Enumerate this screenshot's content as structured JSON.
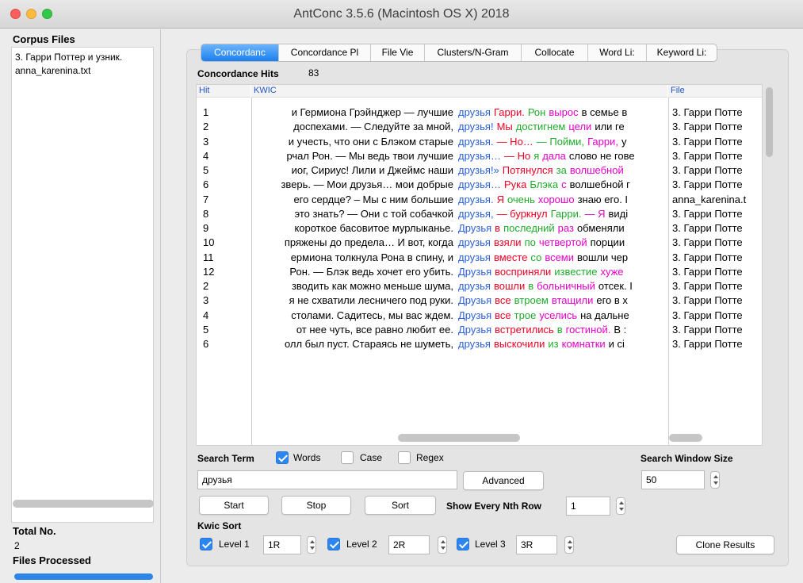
{
  "window": {
    "title": "AntConc 3.5.6 (Macintosh OS X) 2018"
  },
  "left_pane": {
    "corpus_heading": "Corpus Files",
    "files": [
      "3. Гарри Поттер и узник.",
      "anna_karenina.txt"
    ],
    "total_label": "Total No.",
    "total_value": "2",
    "files_processed_label": "Files Processed",
    "progress_fraction": 1.0
  },
  "tabs": [
    "Concordanc",
    "Concordance Pl",
    "File Vie",
    "Clusters/N-Gram",
    "Collocate",
    "Word Li:",
    "Keyword Li:"
  ],
  "active_tab": 0,
  "hits": {
    "label": "Concordance Hits",
    "count": "83"
  },
  "columns": {
    "hit": "Hit",
    "kwic": "KWIC",
    "file": "File"
  },
  "rows": [
    {
      "hit": "1",
      "left": "и Гермиона Грэйнджер — лучшие",
      "right": [
        [
          "друзья",
          "blue"
        ],
        [
          "Гарри.",
          "red"
        ],
        [
          "Рон",
          "green"
        ],
        [
          "вырос",
          "mag"
        ],
        [
          "в семье в",
          "black"
        ]
      ],
      "file": "3. Гарри Потте"
    },
    {
      "hit": "2",
      "left": "доспехами. — Следуйте за мной,",
      "right": [
        [
          "друзья!",
          "blue"
        ],
        [
          "Мы",
          "red"
        ],
        [
          "достигнем",
          "green"
        ],
        [
          "цели",
          "mag"
        ],
        [
          "или ге",
          "black"
        ]
      ],
      "file": "3. Гарри Потте"
    },
    {
      "hit": "3",
      "left": "и учесть, что они с Блэком старые",
      "right": [
        [
          "друзья.",
          "blue"
        ],
        [
          "— Но…",
          "red"
        ],
        [
          "— Пойми,",
          "green"
        ],
        [
          "Гарри,",
          "mag"
        ],
        [
          "у",
          "black"
        ]
      ],
      "file": "3. Гарри Потте"
    },
    {
      "hit": "4",
      "left": "рчал Рон. — Мы ведь твои лучшие",
      "right": [
        [
          "друзья…",
          "blue"
        ],
        [
          "— Но",
          "red"
        ],
        [
          "я",
          "green"
        ],
        [
          "дала",
          "mag"
        ],
        [
          "слово не гове",
          "black"
        ]
      ],
      "file": "3. Гарри Потте"
    },
    {
      "hit": "5",
      "left": "иог, Сириус! Лили и Джеймс наши",
      "right": [
        [
          "друзья!»",
          "blue"
        ],
        [
          "Потянулся",
          "red"
        ],
        [
          "за",
          "green"
        ],
        [
          "волшебной",
          "mag"
        ]
      ],
      "file": "3. Гарри Потте"
    },
    {
      "hit": "6",
      "left": "зверь. — Мои друзья… мои добрые",
      "right": [
        [
          "друзья…",
          "blue"
        ],
        [
          "Рука",
          "red"
        ],
        [
          "Блэка",
          "green"
        ],
        [
          "с",
          "mag"
        ],
        [
          "волшебной г",
          "black"
        ]
      ],
      "file": "3. Гарри Потте"
    },
    {
      "hit": "7",
      "left": "его сердце? – Мы с ним большие",
      "right": [
        [
          "друзья.",
          "blue"
        ],
        [
          "Я",
          "red"
        ],
        [
          "очень",
          "green"
        ],
        [
          "хорошо",
          "mag"
        ],
        [
          "знаю его. І",
          "black"
        ]
      ],
      "file": "anna_karenina.t"
    },
    {
      "hit": "8",
      "left": "это знать? — Они с той собачкой",
      "right": [
        [
          "друзья,",
          "blue"
        ],
        [
          "— буркнул",
          "red"
        ],
        [
          "Гарри.",
          "green"
        ],
        [
          "— Я",
          "mag"
        ],
        [
          "виді",
          "black"
        ]
      ],
      "file": "3. Гарри Потте"
    },
    {
      "hit": "9",
      "left": "короткое басовитое мурлыканье.",
      "right": [
        [
          "Друзья",
          "blue"
        ],
        [
          "в",
          "red"
        ],
        [
          "последний",
          "green"
        ],
        [
          "раз",
          "mag"
        ],
        [
          "обменяли",
          "black"
        ]
      ],
      "file": "3. Гарри Потте"
    },
    {
      "hit": "10",
      "left": "пряжены до предела… И вот, когда",
      "right": [
        [
          "друзья",
          "blue"
        ],
        [
          "взяли",
          "red"
        ],
        [
          "по",
          "green"
        ],
        [
          "четвертой",
          "mag"
        ],
        [
          "порции",
          "black"
        ]
      ],
      "file": "3. Гарри Потте"
    },
    {
      "hit": "11",
      "left": "ермиона толкнула Рона в спину, и",
      "right": [
        [
          "друзья",
          "blue"
        ],
        [
          "вместе",
          "red"
        ],
        [
          "со",
          "green"
        ],
        [
          "всеми",
          "mag"
        ],
        [
          "вошли чер",
          "black"
        ]
      ],
      "file": "3. Гарри Потте"
    },
    {
      "hit": "12",
      "left": "Рон. — Блэк ведь хочет его убить.",
      "right": [
        [
          "Друзья",
          "blue"
        ],
        [
          "восприняли",
          "red"
        ],
        [
          "известие",
          "green"
        ],
        [
          "хуже",
          "mag"
        ]
      ],
      "file": "3. Гарри Потте"
    },
    {
      "hit": "2",
      "left": "зводить как можно меньше шума,",
      "right": [
        [
          "друзья",
          "blue"
        ],
        [
          "вошли",
          "red"
        ],
        [
          "в",
          "green"
        ],
        [
          "больничный",
          "mag"
        ],
        [
          "отсек. І",
          "black"
        ]
      ],
      "file": "3. Гарри Потте"
    },
    {
      "hit": "3",
      "left": "я не схватили лесничего под руки.",
      "right": [
        [
          "Друзья",
          "blue"
        ],
        [
          "все",
          "red"
        ],
        [
          "втроем",
          "green"
        ],
        [
          "втащили",
          "mag"
        ],
        [
          "его в х",
          "black"
        ]
      ],
      "file": "3. Гарри Потте"
    },
    {
      "hit": "4",
      "left": "столами. Садитесь, мы вас ждем.",
      "right": [
        [
          "Друзья",
          "blue"
        ],
        [
          "все",
          "red"
        ],
        [
          "трое",
          "green"
        ],
        [
          "уселись",
          "mag"
        ],
        [
          "на дальне",
          "black"
        ]
      ],
      "file": "3. Гарри Потте"
    },
    {
      "hit": "5",
      "left": "от нее чуть, все равно любит ее.",
      "right": [
        [
          "Друзья",
          "blue"
        ],
        [
          "встретились",
          "red"
        ],
        [
          "в",
          "green"
        ],
        [
          "гостиной.",
          "mag"
        ],
        [
          "В :",
          "black"
        ]
      ],
      "file": "3. Гарри Потте"
    },
    {
      "hit": "6",
      "left": "олл был пуст. Стараясь не шуметь,",
      "right": [
        [
          "друзья",
          "blue"
        ],
        [
          "выскочили",
          "red"
        ],
        [
          "из",
          "green"
        ],
        [
          "комнатки",
          "mag"
        ],
        [
          "и сі",
          "black"
        ]
      ],
      "file": "3. Гарри Потте"
    }
  ],
  "search": {
    "term_label": "Search Term",
    "words_label": "Words",
    "words_checked": true,
    "case_label": "Case",
    "case_checked": false,
    "regex_label": "Regex",
    "regex_checked": false,
    "term_value": "друзья",
    "advanced_label": "Advanced",
    "window_size_label": "Search Window Size",
    "window_size_value": "50"
  },
  "buttons": {
    "start": "Start",
    "stop": "Stop",
    "sort": "Sort",
    "clone": "Clone Results"
  },
  "nth_row": {
    "label": "Show Every Nth Row",
    "value": "1"
  },
  "kwic_sort": {
    "heading": "Kwic Sort",
    "levels": [
      {
        "label": "Level 1",
        "value": "1R",
        "checked": true
      },
      {
        "label": "Level 2",
        "value": "2R",
        "checked": true
      },
      {
        "label": "Level 3",
        "value": "3R",
        "checked": true
      }
    ]
  },
  "colors": {
    "blue": "#2b60d7",
    "red": "#f00022",
    "green": "#1fab2a",
    "magenta": "#e600c8",
    "accent": "#2d85f0"
  }
}
